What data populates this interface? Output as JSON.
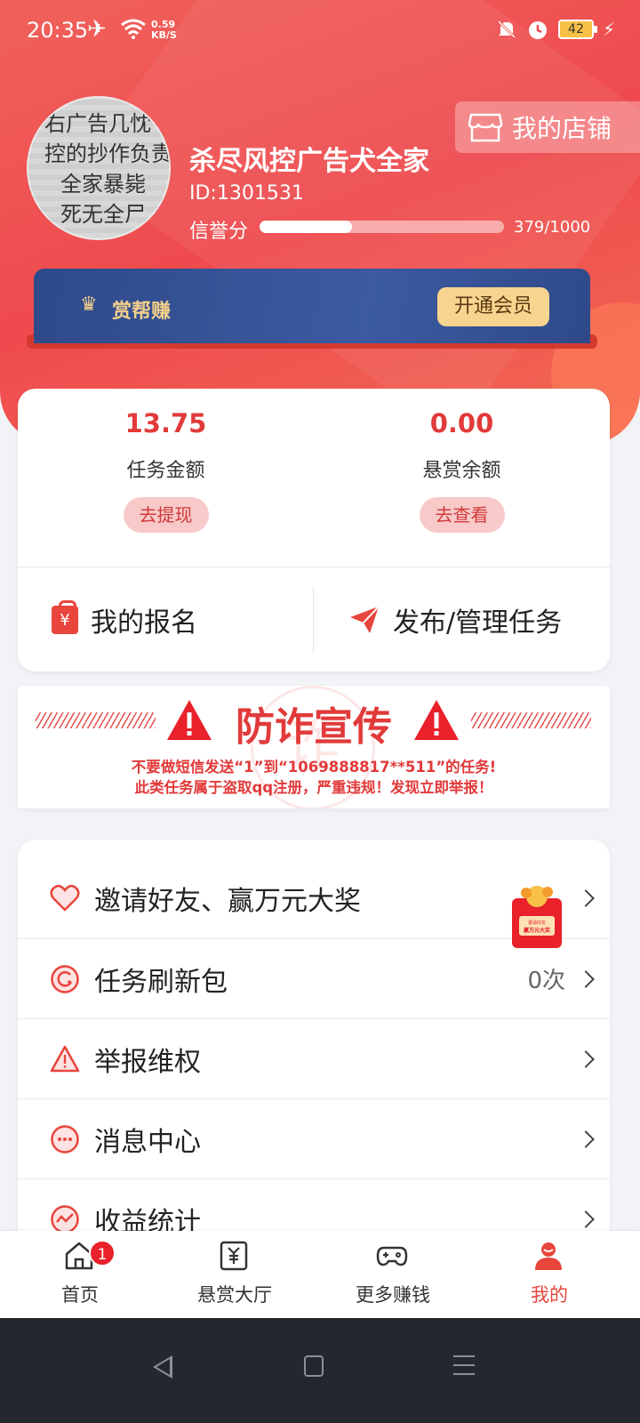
{
  "status_bar": {
    "time": "20:35",
    "net_speed_value": "0.59",
    "net_speed_unit": "KB/S",
    "battery": "42"
  },
  "profile": {
    "avatar_text": [
      "右广告几忱",
      "控的抄作负责人",
      "全家暴毙",
      "死无全尸"
    ],
    "username": "杀尽风控广告犬全家",
    "user_id": "ID:1301531",
    "credit_label": "信誉分",
    "credit_score": 379,
    "credit_max": 1000,
    "credit_text": "379/1000",
    "shop_button": "我的店铺"
  },
  "vip": {
    "label": "赏帮赚",
    "open_button": "开通会员"
  },
  "wallet": {
    "task_amount": "13.75",
    "task_amount_label": "任务金额",
    "withdraw_button": "去提现",
    "reward_balance": "0.00",
    "reward_balance_label": "悬赏余额",
    "view_button": "去查看",
    "my_signup": "我的报名",
    "publish_manage": "发布/管理任务"
  },
  "fraud_banner": {
    "title": "防诈宣传",
    "stamp": "诈",
    "line1": "不要做短信发送“1”到“1069888817**511”的任务!",
    "line2": "此类任务属于盗取qq注册，严重违规！发现立即举报！"
  },
  "menu": {
    "items": [
      {
        "label": "邀请好友、赢万元大奖",
        "icon": "heart-icon",
        "extra": ""
      },
      {
        "label": "任务刷新包",
        "icon": "refresh-icon",
        "extra": "0次"
      },
      {
        "label": "举报维权",
        "icon": "warning-icon",
        "extra": ""
      },
      {
        "label": "消息中心",
        "icon": "message-icon",
        "extra": ""
      },
      {
        "label": "收益统计",
        "icon": "chart-icon",
        "extra": ""
      }
    ],
    "invite_card": {
      "line1": "邀请好友",
      "line2": "赢万元大奖"
    }
  },
  "bottom_nav": {
    "items": [
      {
        "label": "首页",
        "icon": "home-icon",
        "badge": "1"
      },
      {
        "label": "悬赏大厅",
        "icon": "reward-hall-icon"
      },
      {
        "label": "更多赚钱",
        "icon": "gamepad-icon"
      },
      {
        "label": "我的",
        "icon": "profile-icon"
      }
    ],
    "active": "我的"
  },
  "colors": {
    "primary_red": "#e8453c",
    "vip_blue": "#3b5aa0",
    "vip_gold": "#f3cf8a"
  }
}
